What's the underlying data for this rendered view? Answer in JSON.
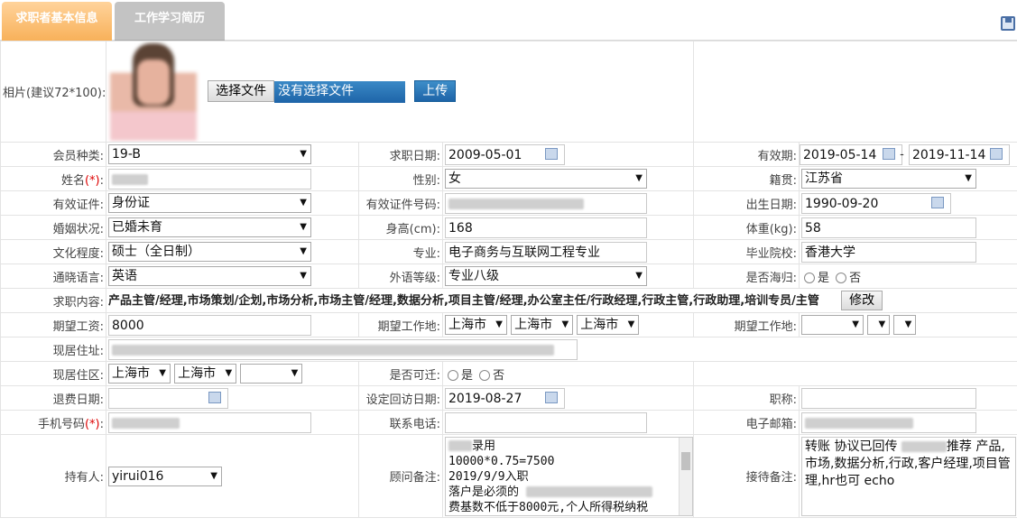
{
  "tabs": [
    {
      "label": "求职者基本信息"
    },
    {
      "label": "工作学习简历"
    }
  ],
  "photo": {
    "label": "相片(建议72*100):",
    "choose_file": "选择文件",
    "no_file": "没有选择文件",
    "upload": "上传"
  },
  "row1": {
    "member_label": "会员种类:",
    "member_value": "19-B",
    "apply_date_label": "求职日期:",
    "apply_date_value": "2009-05-01",
    "valid_label": "有效期:",
    "valid_from": "2019-05-14",
    "valid_sep": "-",
    "valid_to": "2019-11-14"
  },
  "row2": {
    "name_label": "姓名",
    "req": "(*)",
    "colon": ":",
    "gender_label": "性别:",
    "gender_value": "女",
    "origin_label": "籍贯:",
    "origin_value": "江苏省"
  },
  "row3": {
    "id_type_label": "有效证件:",
    "id_type_value": "身份证",
    "id_no_label": "有效证件号码:",
    "birth_label": "出生日期:",
    "birth_value": "1990-09-20"
  },
  "row4": {
    "marital_label": "婚姻状况:",
    "marital_value": "已婚未育",
    "height_label": "身高(cm):",
    "height_value": "168",
    "weight_label": "体重(kg):",
    "weight_value": "58"
  },
  "row5": {
    "edu_label": "文化程度:",
    "edu_value": "硕士（全日制）",
    "major_label": "专业:",
    "major_value": "电子商务与互联网工程专业",
    "school_label": "毕业院校:",
    "school_value": "香港大学"
  },
  "row6": {
    "lang_label": "通晓语言:",
    "lang_value": "英语",
    "lang_level_label": "外语等级:",
    "lang_level_value": "专业八级",
    "returnee_label": "是否海归:",
    "yes": "是",
    "no": "否"
  },
  "row7": {
    "job_label": "求职内容:",
    "job_value": "产品主管/经理,市场策划/企划,市场分析,市场主管/经理,数据分析,项目主管/经理,办公室主任/行政经理,行政主管,行政助理,培训专员/主管",
    "edit": "修改"
  },
  "row8": {
    "salary_label": "期望工资:",
    "salary_value": "8000",
    "workplace_label": "期望工作地:",
    "wp1": "上海市",
    "wp2": "上海市",
    "wp3": "上海市",
    "workplace2_label": "期望工作地:"
  },
  "row9": {
    "addr_label": "现居住址:"
  },
  "row10": {
    "area_label": "现居住区:",
    "area1": "上海市",
    "area2": "上海市",
    "relocate_label": "是否可迁:",
    "yes": "是",
    "no": "否"
  },
  "row11": {
    "refund_label": "退费日期:",
    "visit_label": "设定回访日期:",
    "visit_value": "2019-08-27",
    "title_label": "职称:"
  },
  "row12": {
    "mobile_label": "手机号码",
    "req": "(*)",
    "colon": ":",
    "phone_label": "联系电话:",
    "email_label": "电子邮箱:"
  },
  "row13": {
    "owner_label": "持有人:",
    "owner_value": "yirui016",
    "advisor_note_label": "顾问备注:",
    "advisor_note_l1": "录用",
    "advisor_note_l2": "10000*0.75=7500",
    "advisor_note_l3": "2019/9/9入职",
    "advisor_note_l4": "落户是必须的",
    "advisor_note_l5": "费基数不低于8000元,个人所得税纳税",
    "reception_note_label": "接待备注:",
    "reception_note_a": "转账 协议已回传",
    "reception_note_b": "推荐 产品,市场,数据分析,行政,客户经理,项目管理,hr也可  echo"
  }
}
